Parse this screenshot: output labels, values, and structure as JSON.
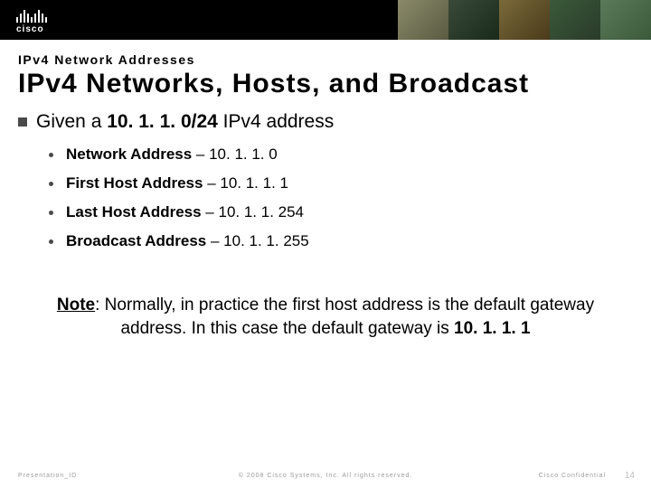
{
  "brand": {
    "name": "cisco"
  },
  "header": {
    "subtitle": "IPv4 Network Addresses",
    "title": "IPv4 Networks, Hosts, and Broadcast"
  },
  "lead": {
    "prefix": "Given a ",
    "bold": "10. 1. 1. 0/24",
    "suffix": " IPv4 address"
  },
  "items": [
    {
      "label": "Network Address",
      "value": "10. 1. 1. 0"
    },
    {
      "label": "First Host Address",
      "value": "10. 1. 1. 1"
    },
    {
      "label": "Last Host Address",
      "value": "10. 1. 1. 254"
    },
    {
      "label": "Broadcast Address",
      "value": "10. 1. 1. 255"
    }
  ],
  "note": {
    "label": "Note",
    "body_before": ": Normally, in practice the first host address is the default gateway address. In this case the default gateway is ",
    "gateway": "10. 1. 1. 1"
  },
  "footer": {
    "id": "Presentation_ID",
    "copyright": "© 2008 Cisco Systems, Inc. All rights reserved.",
    "confidential": "Cisco Confidential",
    "page": "14"
  }
}
